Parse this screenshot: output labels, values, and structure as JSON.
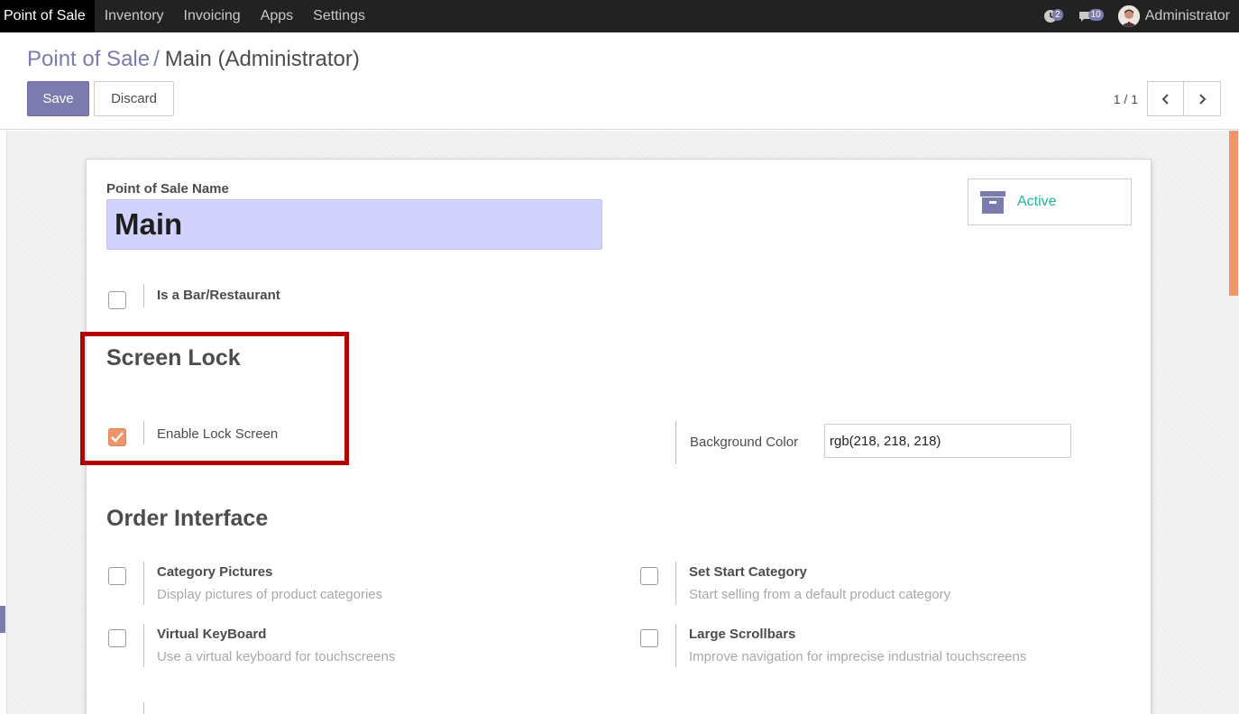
{
  "navbar": {
    "app_name": "Point of Sale",
    "menu": [
      "Inventory",
      "Invoicing",
      "Apps",
      "Settings"
    ],
    "activity_count": "2",
    "message_count": "10",
    "user_name": "Administrator"
  },
  "control_panel": {
    "breadcrumb_parent": "Point of Sale",
    "breadcrumb_separator": "/",
    "breadcrumb_current": "Main (Administrator)",
    "save_label": "Save",
    "discard_label": "Discard",
    "pager_value": "1 / 1"
  },
  "form": {
    "name_label": "Point of Sale Name",
    "name_value": "Main",
    "active_label": "Active",
    "bar_restaurant_label": "Is a Bar/Restaurant",
    "bar_restaurant_checked": false,
    "screen_lock_title": "Screen Lock",
    "enable_lock_label": "Enable Lock Screen",
    "enable_lock_checked": true,
    "background_color_label": "Background Color",
    "background_color_value": "rgb(218, 218, 218)",
    "order_interface_title": "Order Interface",
    "options": [
      {
        "label": "Category Pictures",
        "help": "Display pictures of product categories",
        "checked": false
      },
      {
        "label": "Set Start Category",
        "help": "Start selling from a default product category",
        "checked": false
      },
      {
        "label": "Virtual KeyBoard",
        "help": "Use a virtual keyboard for touchscreens",
        "checked": false
      },
      {
        "label": "Large Scrollbars",
        "help": "Improve navigation for imprecise industrial touchscreens",
        "checked": false
      }
    ]
  },
  "colors": {
    "accent": "#7c7bad",
    "checkbox_checked": "#f0956a",
    "active_text": "#21b799",
    "highlight_border": "#b30000"
  }
}
